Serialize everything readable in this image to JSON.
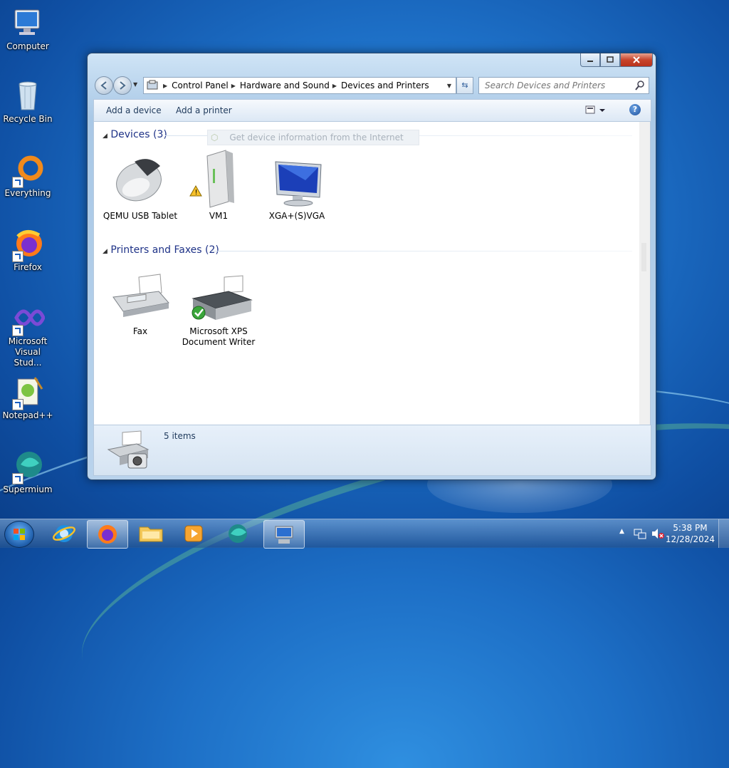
{
  "desktop": {
    "icons": [
      {
        "label": "Computer"
      },
      {
        "label": "Recycle Bin"
      },
      {
        "label": "Everything"
      },
      {
        "label": "Firefox"
      },
      {
        "label": "Microsoft Visual Stud..."
      },
      {
        "label": "Notepad++"
      },
      {
        "label": "Supermium"
      }
    ]
  },
  "explorer": {
    "breadcrumb": [
      "Control Panel",
      "Hardware and Sound",
      "Devices and Printers"
    ],
    "search_placeholder": "Search Devices and Printers",
    "toolbar": {
      "add_device": "Add a device",
      "add_printer": "Add a printer"
    },
    "devices_group": "Devices (3)",
    "info_bar": "Get device information from the Internet",
    "devices": [
      {
        "label": "QEMU USB Tablet"
      },
      {
        "label": "VM1"
      },
      {
        "label": "XGA+(S)VGA"
      }
    ],
    "printers_group": "Printers and Faxes (2)",
    "printers": [
      {
        "label": "Fax"
      },
      {
        "label": "Microsoft XPS Document Writer"
      }
    ],
    "status": "5 items"
  },
  "taskbar": {
    "time": "5:38 PM",
    "date": "12/28/2024"
  }
}
